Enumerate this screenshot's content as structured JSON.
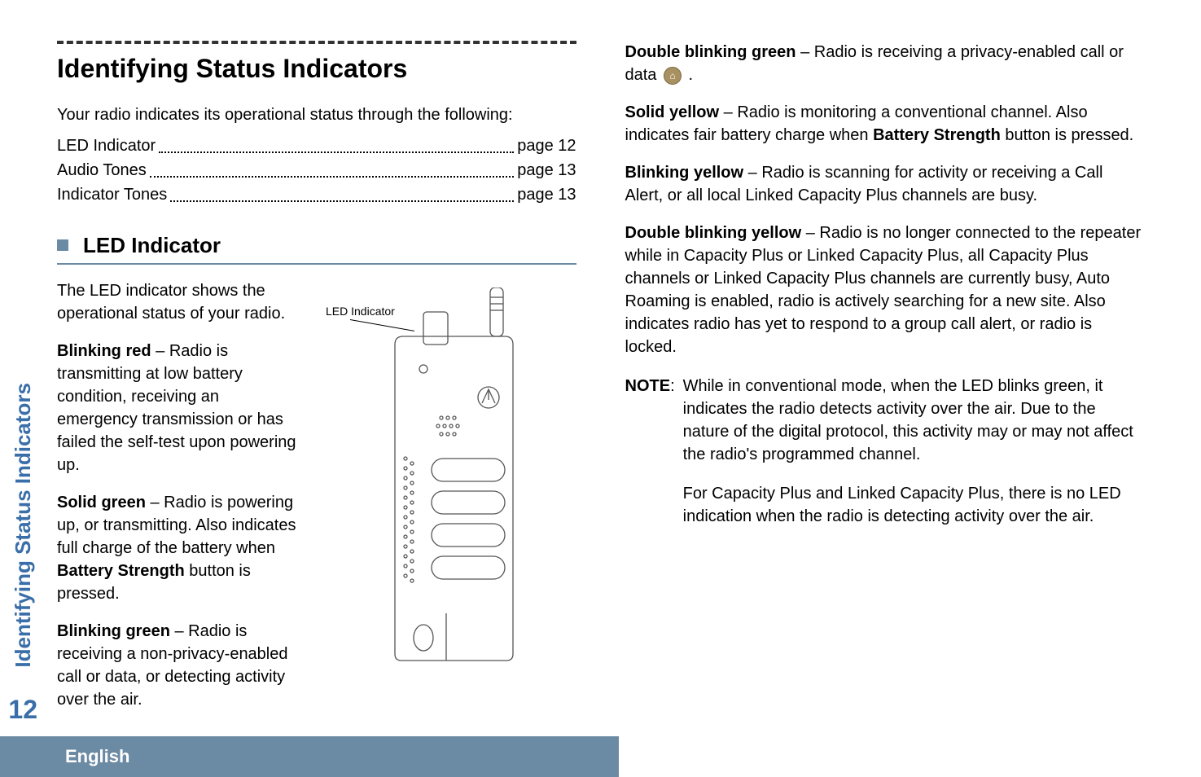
{
  "header": {
    "title": "Identifying Status Indicators",
    "intro": "Your radio indicates its operational status through the following:",
    "toc": [
      {
        "label": "LED Indicator",
        "page": "page 12"
      },
      {
        "label": "Audio Tones",
        "page": "page 13"
      },
      {
        "label": "Indicator Tones",
        "page": "page 13"
      }
    ]
  },
  "section": {
    "title": "LED Indicator",
    "intro": "The LED indicator shows the operational status of your radio.",
    "figure_caption": "LED Indicator"
  },
  "states": {
    "blinking_red": {
      "label": "Blinking red",
      "desc": " – Radio is transmitting at low battery condition, receiving an emergency transmission or has failed the self-test upon powering up."
    },
    "solid_green": {
      "label": "Solid green",
      "desc_part1": " – Radio is powering up, or transmitting. Also indicates full charge of the battery when ",
      "bold": "Battery Strength",
      "desc_part2": " button is pressed."
    },
    "blinking_green": {
      "label": "Blinking green",
      "desc": " – Radio is receiving a non-privacy-enabled call or data, or detecting activity over the air."
    },
    "double_blinking_green": {
      "label": "Double blinking green",
      "desc": " – Radio is receiving a privacy-enabled call or data ",
      "after_icon": " ."
    },
    "solid_yellow": {
      "label": "Solid yellow",
      "desc_part1": " – Radio is monitoring a conventional channel. Also indicates fair battery charge when ",
      "bold": "Battery Strength",
      "desc_part2": " button is pressed."
    },
    "blinking_yellow": {
      "label": "Blinking yellow",
      "desc": " – Radio is scanning for activity or receiving a Call Alert, or all local Linked Capacity Plus channels are busy."
    },
    "double_blinking_yellow": {
      "label": "Double blinking yellow",
      "desc": " – Radio is no longer connected to the repeater while in Capacity Plus or Linked Capacity Plus, all Capacity Plus channels or Linked Capacity Plus channels are currently busy, Auto Roaming is enabled, radio is actively searching for a new site. Also indicates radio has yet to respond to a group call alert, or radio is locked."
    }
  },
  "note": {
    "label": "NOTE",
    "sep": ":",
    "p1": "While in conventional mode, when the LED blinks green, it indicates the radio detects activity over the air. Due to the nature of the digital protocol, this activity may or may not affect the radio's programmed channel.",
    "p2": "For Capacity Plus and Linked Capacity Plus, there is no LED indication when the radio is detecting activity over the air."
  },
  "side": {
    "tab": "Identifying Status Indicators",
    "page_number": "12"
  },
  "footer": {
    "language": "English"
  },
  "icon_glyph": "⌂"
}
